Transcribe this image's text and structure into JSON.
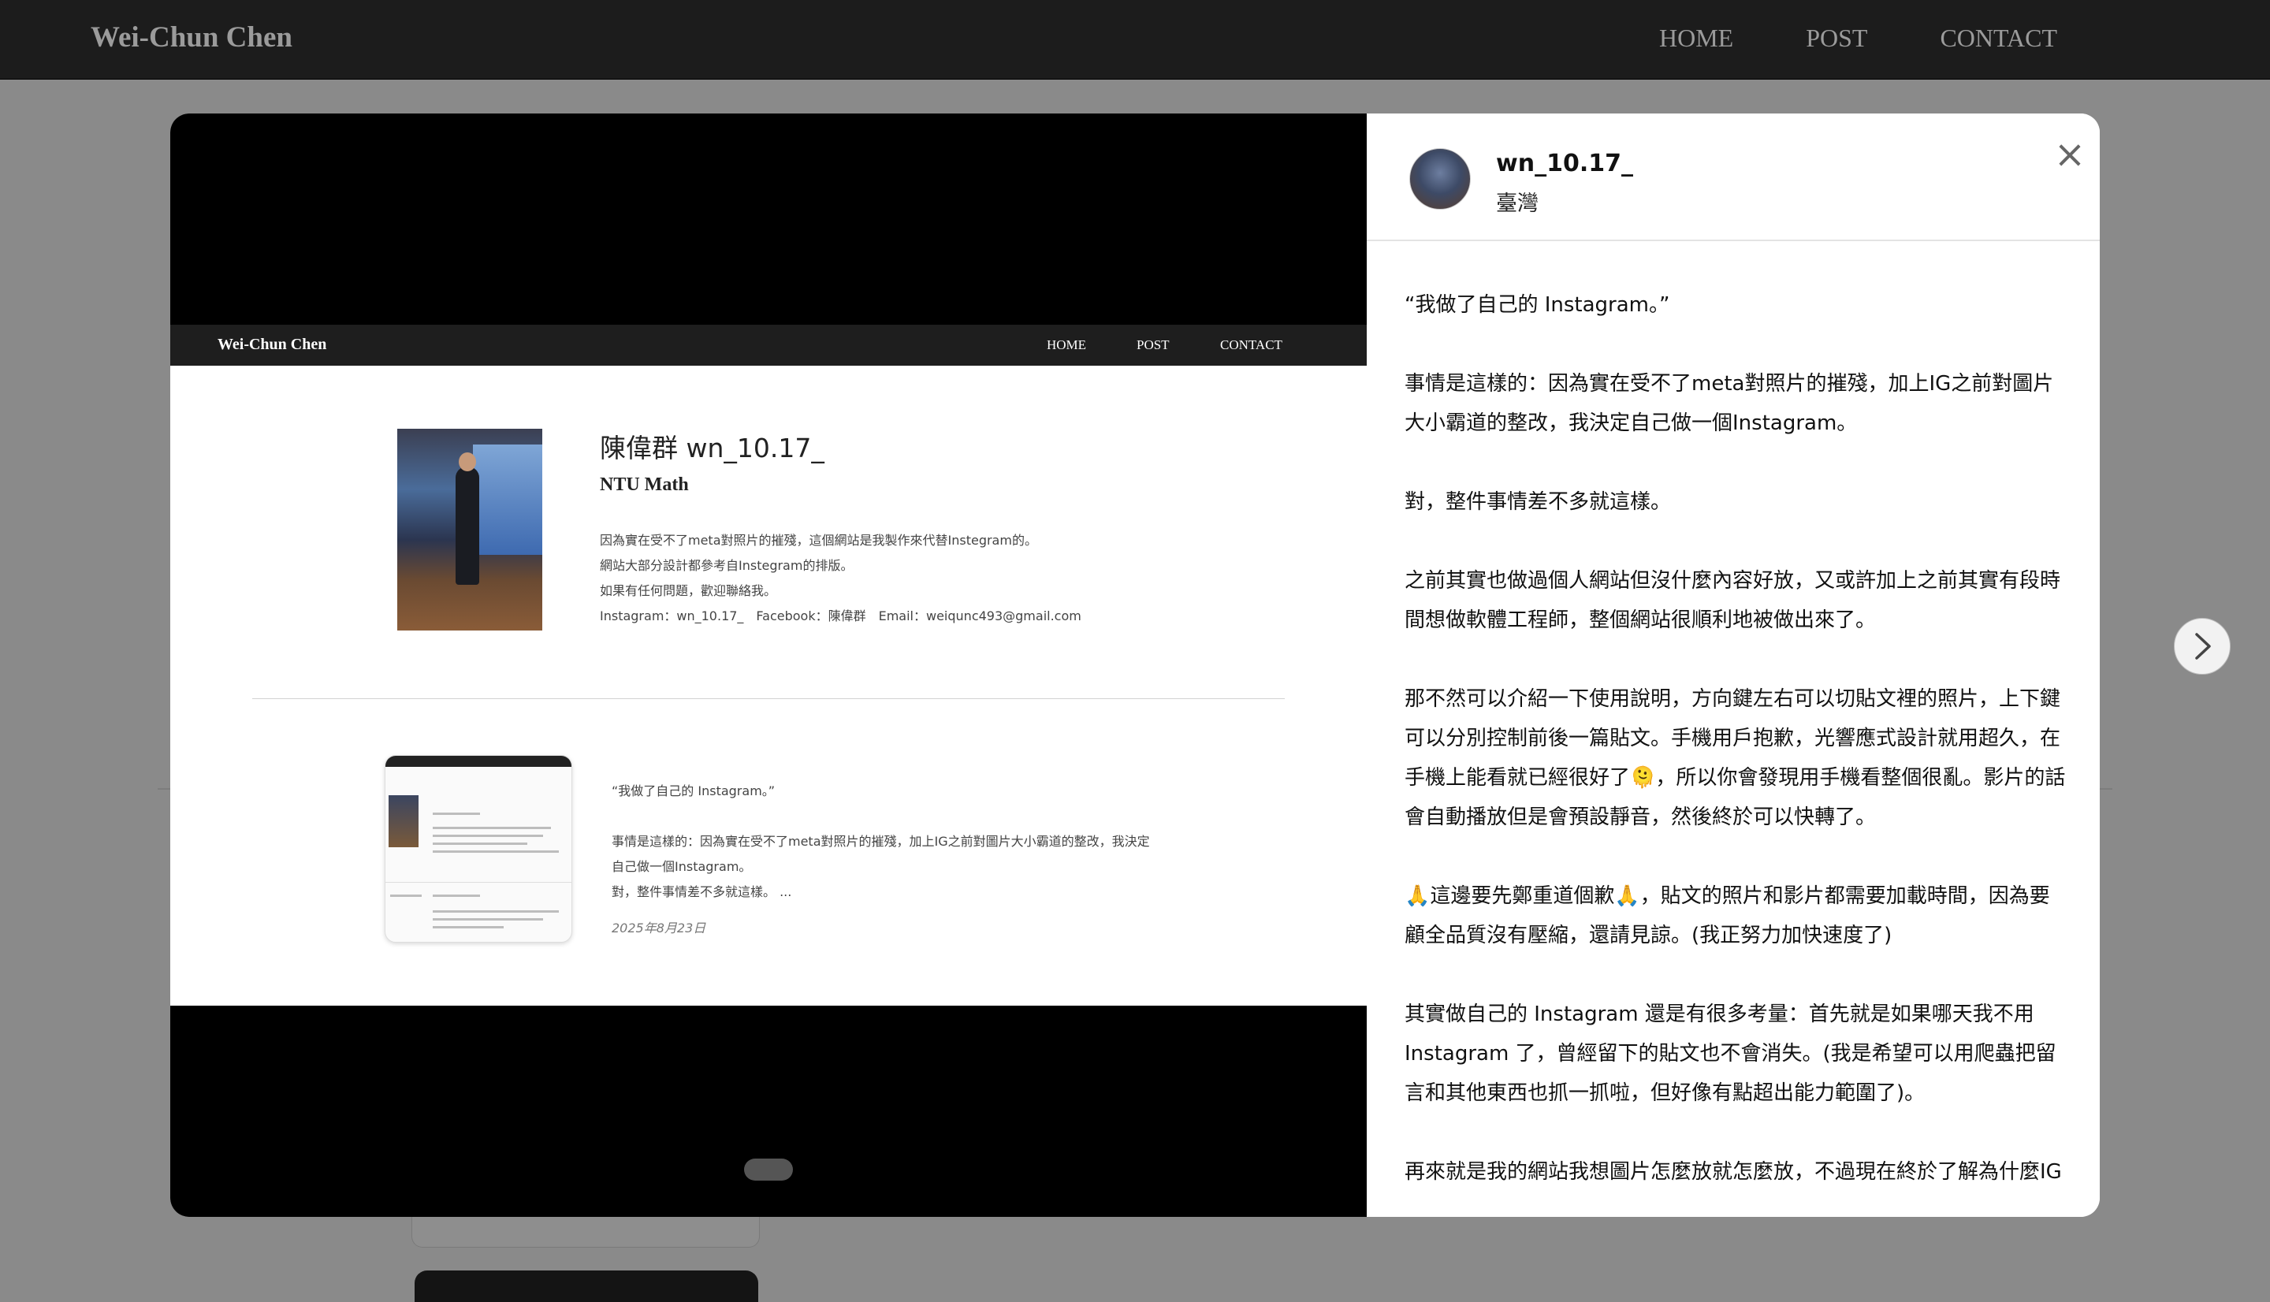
{
  "site": {
    "brand": "Wei-Chun Chen",
    "nav": [
      "HOME",
      "POST",
      "CONTACT"
    ]
  },
  "media": {
    "screenshot": {
      "brand": "Wei-Chun Chen",
      "nav": [
        "HOME",
        "POST",
        "CONTACT"
      ],
      "profile": {
        "title": "陳偉群 wn_10.17_",
        "subtitle": "NTU Math",
        "lines": [
          "因為實在受不了meta對照片的摧殘，這個網站是我製作來代替Instegram的。",
          "網站大部分設計都參考自Instegram的排版。",
          "如果有任何問題，歡迎聯絡我。",
          "Instagram：wn_10.17_　Facebook：陳偉群　Email：weiqunc493@gmail.com"
        ]
      },
      "post": {
        "quote": "“我做了自己的 Instagram。”",
        "body": [
          "事情是這樣的：因為實在受不了meta對照片的摧殘，加上IG之前對圖片大小霸道的整改，我決定",
          "自己做一個Instagram。",
          "對，整件事情差不多就這樣。 ..."
        ],
        "date": "2025年8月23日"
      }
    }
  },
  "panel": {
    "username": "wn_10.17_",
    "location": "臺灣",
    "close_icon": "close-icon",
    "caption": [
      "“我做了自己的 Instagram。”",
      "事情是這樣的：因為實在受不了meta對照片的摧殘，加上IG之前對圖片大小霸道的整改，我決定自己做一個Instagram。",
      "對，整件事情差不多就這樣。",
      "之前其實也做過個人網站但沒什麼內容好放，又或許加上之前其實有段時間想做軟體工程師，整個網站很順利地被做出來了。",
      "那不然可以介紹一下使用說明，方向鍵左右可以切貼文裡的照片，上下鍵可以分別控制前後一篇貼文。手機用戶抱歉，光響應式設計就用超久，在手機上能看就已經很好了🫠，所以你會發現用手機看整個很亂。影片的話會自動播放但是會預設靜音，然後終於可以快轉了。",
      "🙏這邊要先鄭重道個歉🙏，貼文的照片和影片都需要加載時間，因為要顧全品質沒有壓縮，還請見諒。(我正努力加快速度了)",
      "其實做自己的 Instagram 還是有很多考量：首先就是如果哪天我不用 Instagram 了，曾經留下的貼文也不會消失。(我是希望可以用爬蟲把留言和其他東西也抓一抓啦，但好像有點超出能力範圍了)。",
      "再來就是我的網站我想圖片怎麼放就怎麼放，不過現在終於了解為什麼IG"
    ]
  },
  "controls": {
    "next_icon": "chevron-right-icon"
  }
}
